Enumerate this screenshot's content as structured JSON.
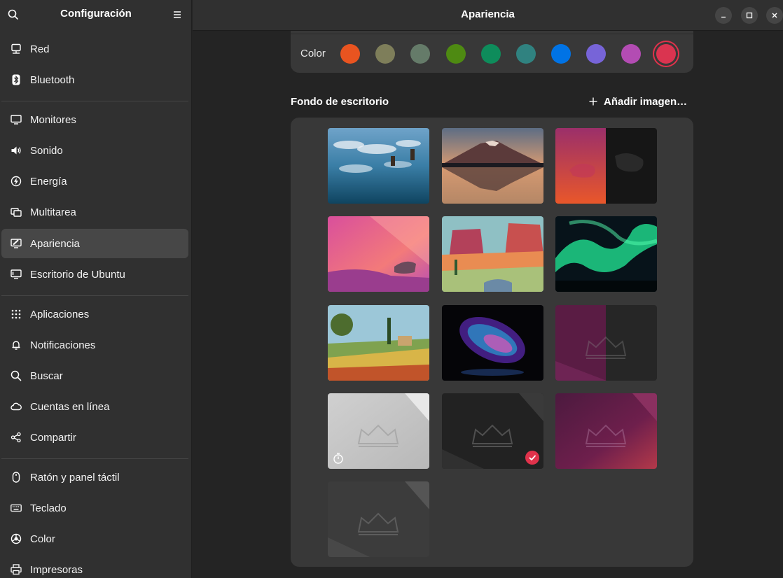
{
  "sidebar": {
    "title": "Configuración",
    "items": [
      {
        "label": "Red",
        "icon": "network-icon"
      },
      {
        "label": "Bluetooth",
        "icon": "bluetooth-icon"
      },
      {
        "label": "Monitores",
        "icon": "monitor-icon"
      },
      {
        "label": "Sonido",
        "icon": "sound-icon"
      },
      {
        "label": "Energía",
        "icon": "power-icon"
      },
      {
        "label": "Multitarea",
        "icon": "multitask-icon"
      },
      {
        "label": "Apariencia",
        "icon": "appearance-icon"
      },
      {
        "label": "Escritorio de Ubuntu",
        "icon": "ubuntu-desktop-icon"
      },
      {
        "label": "Aplicaciones",
        "icon": "apps-grid-icon"
      },
      {
        "label": "Notificaciones",
        "icon": "bell-icon"
      },
      {
        "label": "Buscar",
        "icon": "search-icon"
      },
      {
        "label": "Cuentas en línea",
        "icon": "cloud-icon"
      },
      {
        "label": "Compartir",
        "icon": "share-icon"
      },
      {
        "label": "Ratón y panel táctil",
        "icon": "mouse-icon"
      },
      {
        "label": "Teclado",
        "icon": "keyboard-icon"
      },
      {
        "label": "Color",
        "icon": "color-icon"
      },
      {
        "label": "Impresoras",
        "icon": "printer-icon"
      }
    ],
    "active_index": 6
  },
  "header": {
    "title": "Apariencia"
  },
  "accent": {
    "label": "Color",
    "swatches": [
      "#e95420",
      "#7e7e5a",
      "#657b69",
      "#4e8a12",
      "#0e8c5b",
      "#308280",
      "#0073e5",
      "#7764d8",
      "#b34cb3",
      "#da3450"
    ],
    "selected_index": 9
  },
  "wallpaper": {
    "title": "Fondo de escritorio",
    "add_label": "Añadir imagen…",
    "selected_index": 10,
    "timed_index": 9,
    "items": [
      "clouds-lake",
      "mountain-sunset",
      "numbat-split",
      "numbat-pink",
      "desert-mesas",
      "aurora",
      "countryside",
      "glass-bulb",
      "warty-purple-split",
      "warty-light",
      "warty-dark",
      "warty-purple",
      "warty-gray"
    ]
  }
}
